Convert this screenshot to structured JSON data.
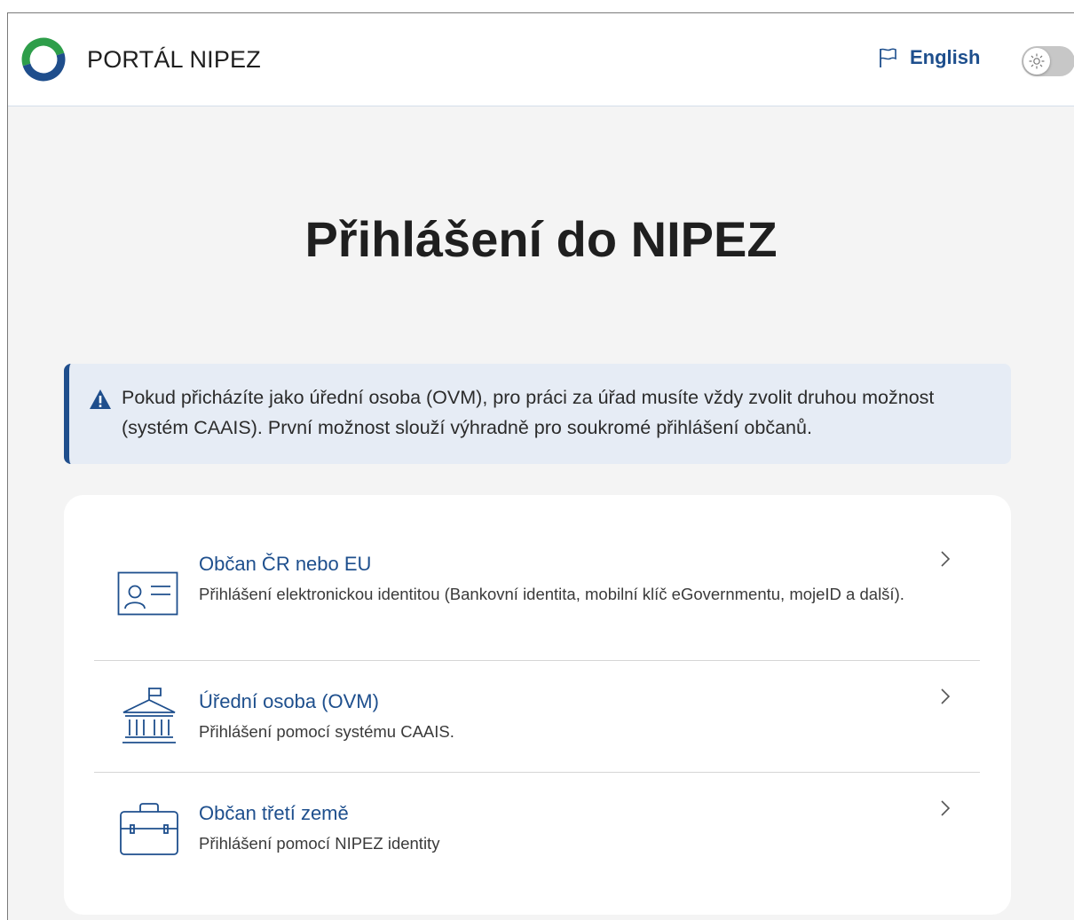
{
  "header": {
    "brand": "PORTÁL NIPEZ",
    "language_link": "English"
  },
  "page": {
    "title": "Přihlášení do NIPEZ"
  },
  "alert": {
    "text": "Pokud přicházíte jako úřední osoba (OVM), pro práci za úřad musíte vždy zvolit druhou možnost (systém CAAIS). První možnost slouží výhradně pro soukromé přihlášení občanů."
  },
  "options": [
    {
      "title": "Občan ČR nebo EU",
      "description": "Přihlášení elektronickou identitou (Bankovní identita, mobilní klíč eGovernmentu, mojeID a další).",
      "icon": "id-card-icon"
    },
    {
      "title": "Úřední osoba (OVM)",
      "description": "Přihlášení pomocí systému CAAIS.",
      "icon": "government-building-icon"
    },
    {
      "title": "Občan třetí země",
      "description": "Přihlášení pomocí NIPEZ identity",
      "icon": "briefcase-icon"
    }
  ],
  "icons": {
    "logo": "nipez-logo-icon",
    "language": "flag-icon",
    "theme_toggle": "sun-icon",
    "warning": "warning-triangle-icon",
    "chevron": "chevron-right-icon"
  },
  "colors": {
    "accent": "#1e4f8d",
    "alert_background": "#e6ecf5",
    "page_background": "#f4f4f4",
    "logo_green": "#2e9e4a",
    "logo_blue": "#1f4e8c",
    "toggle_track": "#c7c7c7"
  }
}
